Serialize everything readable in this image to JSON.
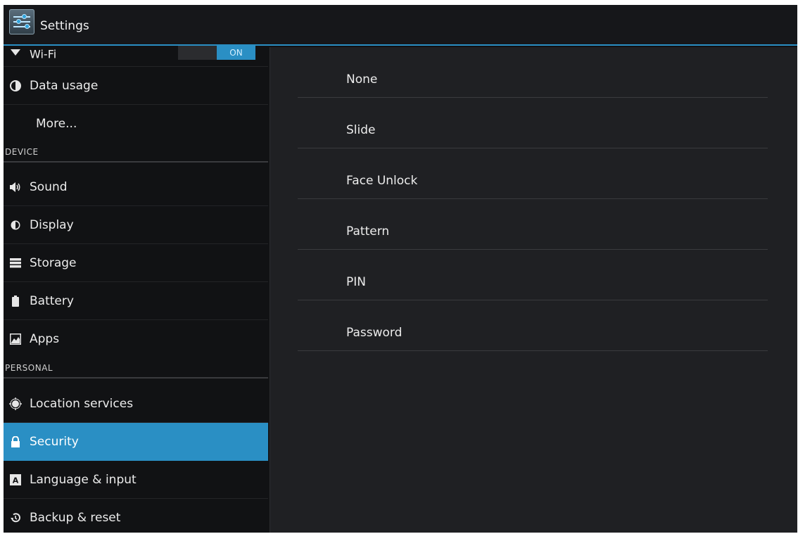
{
  "app": {
    "title": "Settings"
  },
  "wifi": {
    "label": "Wi-Fi",
    "toggle": "ON"
  },
  "sidebar": {
    "items": [
      {
        "label": "Data usage",
        "icon": "pie-chart-icon"
      },
      {
        "label": "More..."
      }
    ],
    "device_header": "DEVICE",
    "device_items": [
      {
        "label": "Sound",
        "icon": "speaker-icon"
      },
      {
        "label": "Display",
        "icon": "brightness-icon"
      },
      {
        "label": "Storage",
        "icon": "storage-icon"
      },
      {
        "label": "Battery",
        "icon": "battery-icon"
      },
      {
        "label": "Apps",
        "icon": "apps-icon"
      }
    ],
    "personal_header": "PERSONAL",
    "personal_items": [
      {
        "label": "Location services",
        "icon": "location-icon"
      },
      {
        "label": "Security",
        "icon": "lock-icon",
        "selected": true
      },
      {
        "label": "Language & input",
        "icon": "keyboard-icon"
      },
      {
        "label": "Backup & reset",
        "icon": "backup-icon"
      }
    ]
  },
  "screen_lock_options": [
    "None",
    "Slide",
    "Face Unlock",
    "Pattern",
    "PIN",
    "Password"
  ],
  "colors": {
    "accent": "#2a8fc4",
    "background": "#111214",
    "panel": "#1f2023"
  }
}
